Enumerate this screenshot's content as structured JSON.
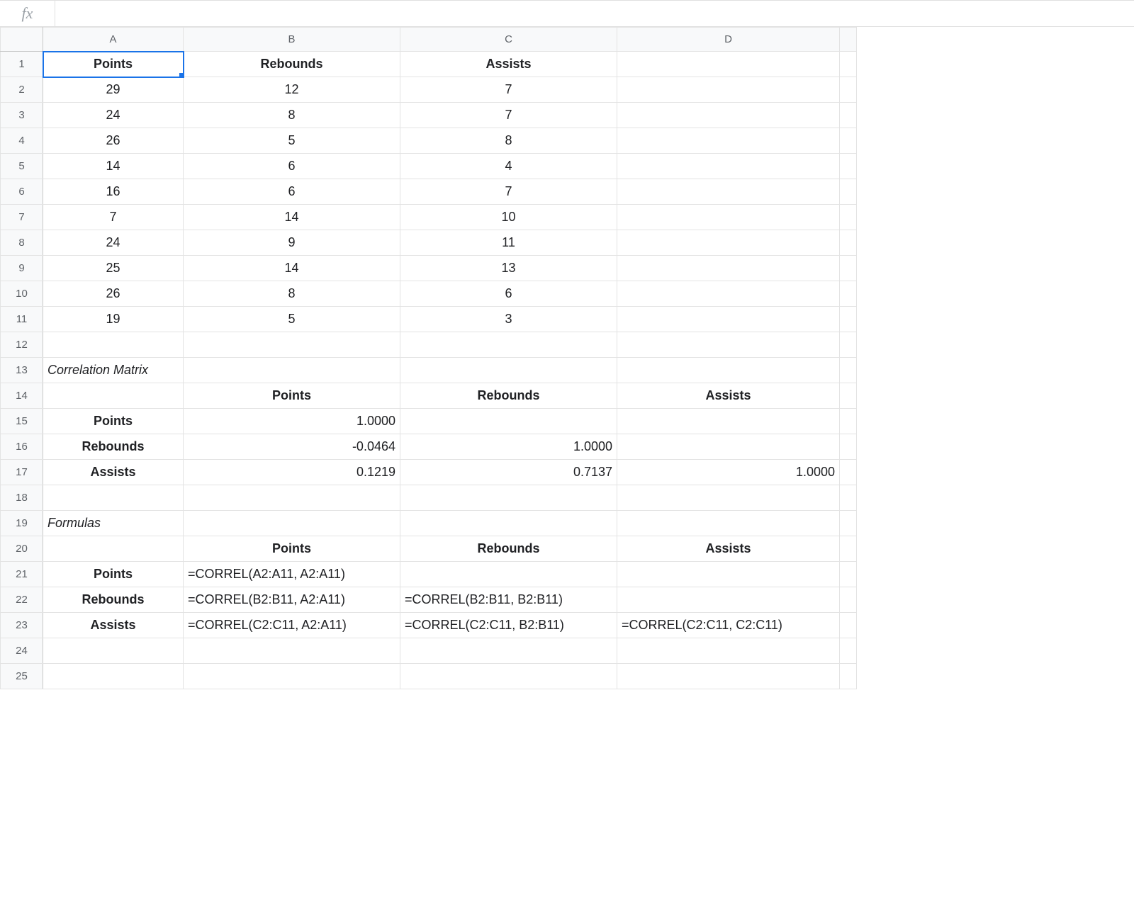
{
  "formula_bar": {
    "fx_symbol": "fx",
    "value": ""
  },
  "columns": [
    "A",
    "B",
    "C",
    "D",
    ""
  ],
  "row_count": 25,
  "cells": {
    "A1": {
      "v": "Points",
      "cls": "bold center",
      "selected": true
    },
    "B1": {
      "v": "Rebounds",
      "cls": "bold center"
    },
    "C1": {
      "v": "Assists",
      "cls": "bold center"
    },
    "A2": {
      "v": "29",
      "cls": "center"
    },
    "B2": {
      "v": "12",
      "cls": "center"
    },
    "C2": {
      "v": "7",
      "cls": "center"
    },
    "A3": {
      "v": "24",
      "cls": "center"
    },
    "B3": {
      "v": "8",
      "cls": "center"
    },
    "C3": {
      "v": "7",
      "cls": "center"
    },
    "A4": {
      "v": "26",
      "cls": "center"
    },
    "B4": {
      "v": "5",
      "cls": "center"
    },
    "C4": {
      "v": "8",
      "cls": "center"
    },
    "A5": {
      "v": "14",
      "cls": "center"
    },
    "B5": {
      "v": "6",
      "cls": "center"
    },
    "C5": {
      "v": "4",
      "cls": "center"
    },
    "A6": {
      "v": "16",
      "cls": "center"
    },
    "B6": {
      "v": "6",
      "cls": "center"
    },
    "C6": {
      "v": "7",
      "cls": "center"
    },
    "A7": {
      "v": "7",
      "cls": "center"
    },
    "B7": {
      "v": "14",
      "cls": "center"
    },
    "C7": {
      "v": "10",
      "cls": "center"
    },
    "A8": {
      "v": "24",
      "cls": "center"
    },
    "B8": {
      "v": "9",
      "cls": "center"
    },
    "C8": {
      "v": "11",
      "cls": "center"
    },
    "A9": {
      "v": "25",
      "cls": "center"
    },
    "B9": {
      "v": "14",
      "cls": "center"
    },
    "C9": {
      "v": "13",
      "cls": "center"
    },
    "A10": {
      "v": "26",
      "cls": "center"
    },
    "B10": {
      "v": "8",
      "cls": "center"
    },
    "C10": {
      "v": "6",
      "cls": "center"
    },
    "A11": {
      "v": "19",
      "cls": "center"
    },
    "B11": {
      "v": "5",
      "cls": "center"
    },
    "C11": {
      "v": "3",
      "cls": "center"
    },
    "A13": {
      "v": "Correlation Matrix",
      "cls": "italic left"
    },
    "B14": {
      "v": "Points",
      "cls": "bold center"
    },
    "C14": {
      "v": "Rebounds",
      "cls": "bold center"
    },
    "D14": {
      "v": "Assists",
      "cls": "bold center"
    },
    "A15": {
      "v": "Points",
      "cls": "bold center"
    },
    "B15": {
      "v": "1.0000",
      "cls": "right"
    },
    "A16": {
      "v": "Rebounds",
      "cls": "bold center"
    },
    "B16": {
      "v": "-0.0464",
      "cls": "right"
    },
    "C16": {
      "v": "1.0000",
      "cls": "right"
    },
    "A17": {
      "v": "Assists",
      "cls": "bold center"
    },
    "B17": {
      "v": "0.1219",
      "cls": "right"
    },
    "C17": {
      "v": "0.7137",
      "cls": "right"
    },
    "D17": {
      "v": "1.0000",
      "cls": "right"
    },
    "A19": {
      "v": "Formulas",
      "cls": "italic left"
    },
    "B20": {
      "v": "Points",
      "cls": "bold center"
    },
    "C20": {
      "v": "Rebounds",
      "cls": "bold center"
    },
    "D20": {
      "v": "Assists",
      "cls": "bold center"
    },
    "A21": {
      "v": "Points",
      "cls": "bold center"
    },
    "B21": {
      "v": "=CORREL(A2:A11, A2:A11)",
      "cls": "left"
    },
    "A22": {
      "v": "Rebounds",
      "cls": "bold center"
    },
    "B22": {
      "v": "=CORREL(B2:B11, A2:A11)",
      "cls": "left"
    },
    "C22": {
      "v": "=CORREL(B2:B11, B2:B11)",
      "cls": "left"
    },
    "A23": {
      "v": "Assists",
      "cls": "bold center"
    },
    "B23": {
      "v": "=CORREL(C2:C11, A2:A11)",
      "cls": "left"
    },
    "C23": {
      "v": "=CORREL(C2:C11, B2:B11)",
      "cls": "left"
    },
    "D23": {
      "v": "=CORREL(C2:C11, C2:C11)",
      "cls": "left"
    }
  }
}
